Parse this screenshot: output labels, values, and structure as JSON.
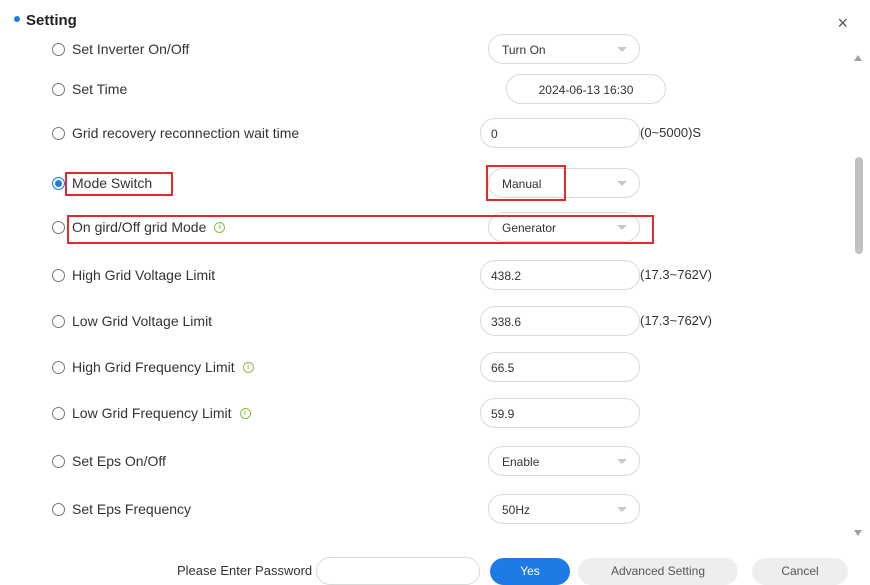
{
  "dialog": {
    "title": "Setting",
    "close_glyph": "×"
  },
  "rows": [
    {
      "label": "Set Inverter On/Off",
      "value": "Turn On",
      "type": "select",
      "checked": false,
      "info": false
    },
    {
      "label": "Set Time",
      "value": "2024-06-13 16:30",
      "type": "datetime",
      "checked": false,
      "info": false
    },
    {
      "label": "Grid recovery reconnection wait time",
      "value": "0",
      "type": "input",
      "range": "(0~5000)S",
      "checked": false,
      "info": false
    },
    {
      "label": "Mode Switch",
      "value": "Manual",
      "type": "select",
      "checked": true,
      "info": false
    },
    {
      "label": "On gird/Off grid Mode",
      "value": "Generator",
      "type": "select",
      "checked": false,
      "info": true
    },
    {
      "label": "High Grid Voltage Limit",
      "value": "438.2",
      "type": "input",
      "range": "(17.3~762V)",
      "checked": false,
      "info": false
    },
    {
      "label": "Low Grid Voltage Limit",
      "value": "338.6",
      "type": "input",
      "range": "(17.3~762V)",
      "checked": false,
      "info": false
    },
    {
      "label": "High Grid Frequency Limit",
      "value": "66.5",
      "type": "input",
      "checked": false,
      "info": true
    },
    {
      "label": "Low Grid Frequency Limit",
      "value": "59.9",
      "type": "input",
      "checked": false,
      "info": true
    },
    {
      "label": "Set Eps On/Off",
      "value": "Enable",
      "type": "select",
      "checked": false,
      "info": false
    },
    {
      "label": "Set Eps Frequency",
      "value": "50Hz",
      "type": "select",
      "checked": false,
      "info": false
    }
  ],
  "footer": {
    "password_label": "Please Enter Password",
    "password_value": "",
    "yes_label": "Yes",
    "advanced_label": "Advanced Setting",
    "cancel_label": "Cancel"
  },
  "colors": {
    "accent": "#1e7be6",
    "highlight": "#e12c2c",
    "info": "#8bbd3c"
  },
  "icons": {
    "info": "info-circle-icon",
    "close": "close-icon",
    "dropdown": "chevron-down-icon"
  }
}
